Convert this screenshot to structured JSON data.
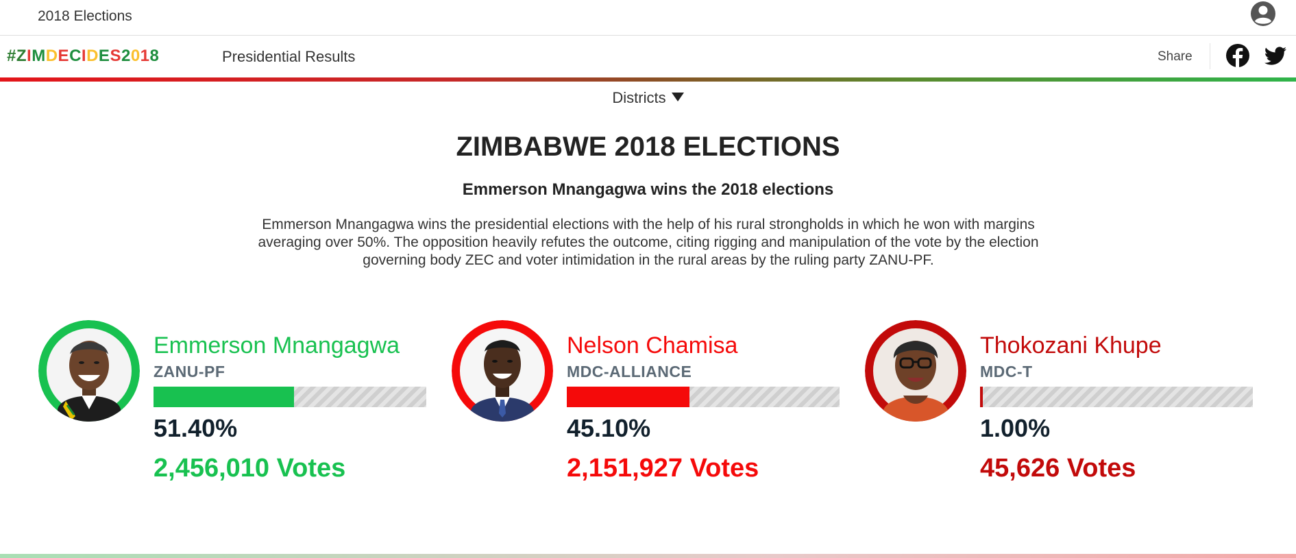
{
  "header": {
    "app_title": "2018 Elections",
    "user_icon": "account-circle-icon"
  },
  "nav": {
    "brand_segments": [
      {
        "text": "#",
        "color": "#2e7d32"
      },
      {
        "text": "Z",
        "color": "#2e7d32"
      },
      {
        "text": "I",
        "color": "#e53935"
      },
      {
        "text": "M",
        "color": "#1e8e3e"
      },
      {
        "text": "D",
        "color": "#fbc02d"
      },
      {
        "text": "E",
        "color": "#e53935"
      },
      {
        "text": "C",
        "color": "#1e8e3e"
      },
      {
        "text": "I",
        "color": "#e53935"
      },
      {
        "text": "D",
        "color": "#fbc02d"
      },
      {
        "text": "E",
        "color": "#1e8e3e"
      },
      {
        "text": "S",
        "color": "#e53935"
      },
      {
        "text": "2",
        "color": "#1e8e3e"
      },
      {
        "text": "0",
        "color": "#fbc02d"
      },
      {
        "text": "1",
        "color": "#e53935"
      },
      {
        "text": "8",
        "color": "#1e8e3e"
      }
    ],
    "link_label": "Presidential Results",
    "share_label": "Share",
    "social": [
      "facebook-icon",
      "twitter-icon"
    ]
  },
  "filter": {
    "label": "Districts"
  },
  "content": {
    "headline": "ZIMBABWE 2018 ELECTIONS",
    "subheadline": "Emmerson Mnangagwa wins the 2018 elections",
    "summary": "Emmerson Mnangagwa wins the presidential elections with the help of his rural strongholds in which he won with margins averaging over 50%. The opposition heavily refutes the outcome, citing rigging and manipulation of the vote by the election governing body ZEC and voter intimidation in the rural areas by the ruling party ZANU-PF."
  },
  "candidates": [
    {
      "name": "Emmerson Mnangagwa",
      "party": "ZANU-PF",
      "percent_label": "51.40%",
      "percent": 51.4,
      "votes_label": "2,456,010 Votes",
      "color": "#18c150",
      "avatar_bg": "#18c150"
    },
    {
      "name": "Nelson Chamisa",
      "party": "MDC-ALLIANCE",
      "percent_label": "45.10%",
      "percent": 45.1,
      "votes_label": "2,151,927 Votes",
      "color": "#f50a0a",
      "avatar_bg": "#f50a0a"
    },
    {
      "name": "Thokozani Khupe",
      "party": "MDC-T",
      "percent_label": "1.00%",
      "percent": 1.0,
      "votes_label": "45,626 Votes",
      "color": "#c20a0a",
      "avatar_bg": "#c20a0a"
    }
  ]
}
